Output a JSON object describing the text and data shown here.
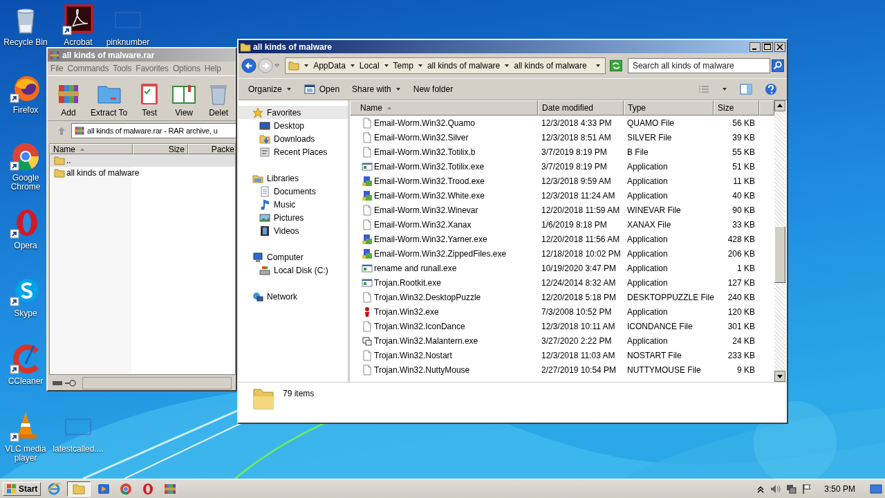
{
  "desktop": {
    "icons": [
      {
        "label": "Recycle Bin",
        "kind": "trash",
        "shortcut": false
      },
      {
        "label": "Acrobat",
        "kind": "acrobat",
        "shortcut": true
      },
      {
        "label": "pinknumber",
        "kind": "blank",
        "shortcut": false
      },
      {
        "label": "Firefox",
        "kind": "firefox",
        "shortcut": true
      },
      {
        "label": "Google Chrome",
        "kind": "chrome",
        "shortcut": true
      },
      {
        "label": "Opera",
        "kind": "opera",
        "shortcut": true
      },
      {
        "label": "Skype",
        "kind": "skype",
        "shortcut": true
      },
      {
        "label": "CCleaner",
        "kind": "ccleaner",
        "shortcut": true
      },
      {
        "label": "VLC media player",
        "kind": "vlc",
        "shortcut": true
      },
      {
        "label": "latestcalled....",
        "kind": "blank",
        "shortcut": false
      }
    ]
  },
  "archive_window": {
    "title": "all kinds of malware.rar",
    "active": false,
    "menu": [
      "File",
      "Commands",
      "Tools",
      "Favorites",
      "Options",
      "Help"
    ],
    "toolbar": [
      {
        "label": "Add",
        "kind": "add"
      },
      {
        "label": "Extract To",
        "kind": "extract"
      },
      {
        "label": "Test",
        "kind": "test"
      },
      {
        "label": "View",
        "kind": "view"
      },
      {
        "label": "Delet",
        "kind": "delete"
      }
    ],
    "path": "all kinds of malware.rar - RAR archive, u",
    "columns": [
      {
        "label": "Name",
        "sorted": true
      },
      {
        "label": "Size",
        "sorted": false
      },
      {
        "label": "Packe",
        "sorted": false
      }
    ],
    "rows": [
      {
        "name": "..",
        "selected": true
      },
      {
        "name": "all kinds of malware",
        "selected": false
      }
    ]
  },
  "explorer_window": {
    "title": "all kinds of malware",
    "active": true,
    "breadcrumbs": [
      "AppData",
      "Local",
      "Temp",
      "all kinds of malware",
      "all kinds of malware"
    ],
    "search": {
      "placeholder": "Search all kinds of malware"
    },
    "toolbar": [
      {
        "label": "Organize",
        "kind": "menu"
      },
      {
        "label": "Open",
        "kind": "icon"
      },
      {
        "label": "Share with",
        "kind": "menu"
      },
      {
        "label": "New folder",
        "kind": "plain"
      }
    ],
    "sidebar": [
      {
        "label": "Favorites",
        "kind": "star",
        "selected": true,
        "children": [
          {
            "label": "Desktop",
            "kind": "desktop",
            "selected": false
          },
          {
            "label": "Downloads",
            "kind": "downloads",
            "selected": false
          },
          {
            "label": "Recent Places",
            "kind": "recent",
            "selected": false
          }
        ]
      },
      {
        "label": "Libraries",
        "kind": "library",
        "selected": false,
        "children": [
          {
            "label": "Documents",
            "kind": "documents",
            "selected": false
          },
          {
            "label": "Music",
            "kind": "music",
            "selected": false
          },
          {
            "label": "Pictures",
            "kind": "pictures",
            "selected": false
          },
          {
            "label": "Videos",
            "kind": "videos",
            "selected": false
          }
        ]
      },
      {
        "label": "Computer",
        "kind": "computer",
        "selected": false,
        "children": [
          {
            "label": "Local Disk (C:)",
            "kind": "disk",
            "selected": false
          }
        ]
      },
      {
        "label": "Network",
        "kind": "network",
        "selected": false
      }
    ],
    "columns": [
      {
        "label": "Name",
        "sorted": true
      },
      {
        "label": "Date modified",
        "sorted": false
      },
      {
        "label": "Type",
        "sorted": false
      },
      {
        "label": "Size",
        "sorted": false
      }
    ],
    "rows": [
      {
        "name": "Email-Worm.Win32.Quamo",
        "kind": "doc",
        "date": "12/3/2018 4:33 PM",
        "type": "QUAMO File",
        "size": "56 KB"
      },
      {
        "name": "Email-Worm.Win32.Silver",
        "kind": "doc",
        "date": "12/3/2018 8:51 AM",
        "type": "SILVER File",
        "size": "39 KB"
      },
      {
        "name": "Email-Worm.Win32.Totilix.b",
        "kind": "doc",
        "date": "3/7/2019 8:19 PM",
        "type": "B File",
        "size": "55 KB"
      },
      {
        "name": "Email-Worm.Win32.Totilix.exe",
        "kind": "app",
        "date": "3/7/2019 8:19 PM",
        "type": "Application",
        "size": "51 KB"
      },
      {
        "name": "Email-Worm.Win32.Trood.exe",
        "kind": "program",
        "date": "12/3/2018 9:59 AM",
        "type": "Application",
        "size": "11 KB"
      },
      {
        "name": "Email-Worm.Win32.White.exe",
        "kind": "program",
        "date": "12/3/2018 11:24 AM",
        "type": "Application",
        "size": "40 KB"
      },
      {
        "name": "Email-Worm.Win32.Winevar",
        "kind": "doc",
        "date": "12/20/2018 11:59 AM",
        "type": "WINEVAR File",
        "size": "90 KB"
      },
      {
        "name": "Email-Worm.Win32.Xanax",
        "kind": "doc",
        "date": "1/6/2019 8:18 PM",
        "type": "XANAX File",
        "size": "33 KB"
      },
      {
        "name": "Email-Worm.Win32.Yarner.exe",
        "kind": "program",
        "date": "12/20/2018 11:56 AM",
        "type": "Application",
        "size": "428 KB"
      },
      {
        "name": "Email-Worm.Win32.ZippedFiles.exe",
        "kind": "program",
        "date": "12/18/2018 10:02 PM",
        "type": "Application",
        "size": "206 KB"
      },
      {
        "name": "rename and runall.exe",
        "kind": "app",
        "date": "10/19/2020 3:47 PM",
        "type": "Application",
        "size": "1 KB"
      },
      {
        "name": "Trojan.Rootkit.exe",
        "kind": "app",
        "date": "12/24/2014 8:32 AM",
        "type": "Application",
        "size": "127 KB"
      },
      {
        "name": "Trojan.Win32.DesktopPuzzle",
        "kind": "doc",
        "date": "12/20/2018 5:18 PM",
        "type": "DESKTOPPUZZLE File",
        "size": "240 KB"
      },
      {
        "name": "Trojan.Win32.exe",
        "kind": "figure",
        "date": "7/3/2008 10:52 PM",
        "type": "Application",
        "size": "120 KB"
      },
      {
        "name": "Trojan.Win32.IconDance",
        "kind": "doc",
        "date": "12/3/2018 10:11 AM",
        "type": "ICONDANCE File",
        "size": "301 KB"
      },
      {
        "name": "Trojan.Win32.Malantern.exe",
        "kind": "frame",
        "date": "3/27/2020 2:22 PM",
        "type": "Application",
        "size": "24 KB"
      },
      {
        "name": "Trojan.Win32.Nostart",
        "kind": "doc",
        "date": "12/3/2018 11:03 AM",
        "type": "NOSTART File",
        "size": "233 KB"
      },
      {
        "name": "Trojan.Win32.NuttyMouse",
        "kind": "doc",
        "date": "2/27/2019 10:54 PM",
        "type": "NUTTYMOUSE File",
        "size": "9 KB"
      }
    ],
    "status": "79 items"
  },
  "taskbar": {
    "start": "Start",
    "apps": [
      {
        "kind": "ie",
        "active": false
      },
      {
        "kind": "folder",
        "active": true
      },
      {
        "kind": "media",
        "active": false
      },
      {
        "kind": "chrome",
        "active": false
      },
      {
        "kind": "opera",
        "active": false
      },
      {
        "kind": "rar",
        "active": false
      }
    ],
    "clock": "3:50 PM"
  }
}
